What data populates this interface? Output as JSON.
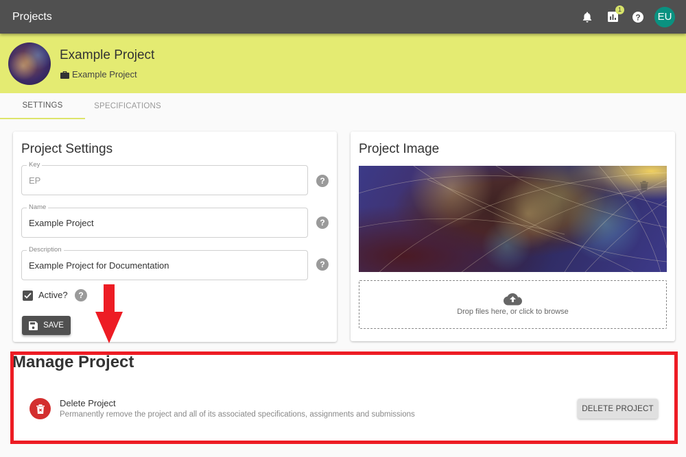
{
  "topbar": {
    "title": "Projects",
    "icons": [
      "bell-icon",
      "bar-chart-icon",
      "help-icon"
    ],
    "notification_badge": "1",
    "avatar_initials": "EU",
    "avatar_color": "#0a9180"
  },
  "project": {
    "name": "Example Project",
    "subtitle": "Example Project",
    "header_color": "#e4eb72"
  },
  "tabs": [
    {
      "label": "SETTINGS",
      "active": true
    },
    {
      "label": "SPECIFICATIONS",
      "active": false
    }
  ],
  "settings_card": {
    "title": "Project Settings",
    "fields": [
      {
        "label": "Key",
        "value": "EP",
        "disabled": true
      },
      {
        "label": "Name",
        "value": "Example Project",
        "disabled": false
      },
      {
        "label": "Description",
        "value": "Example Project for Documentation",
        "disabled": false
      }
    ],
    "active_label": "Active?",
    "active_checked": true,
    "save_label": "SAVE"
  },
  "image_card": {
    "title": "Project Image",
    "dropzone_text": "Drop files here, or click to browse"
  },
  "manage_card": {
    "title": "Manage Project",
    "delete_title": "Delete Project",
    "delete_description": "Permanently remove the project and all of its associated specifications, assignments and submissions",
    "delete_button": "DELETE PROJECT",
    "danger_color": "#d32f2f"
  },
  "annotation": {
    "highlight_color": "#ed1c24"
  }
}
